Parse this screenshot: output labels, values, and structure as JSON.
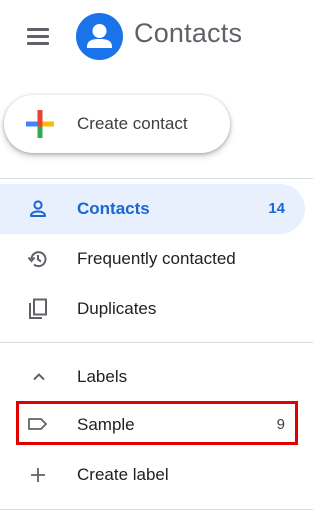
{
  "header": {
    "app_title": "Contacts",
    "menu_icon": "hamburger-menu-icon",
    "logo_icon": "person-avatar-icon",
    "logo_color": "#1a73e8"
  },
  "create_button": {
    "label": "Create contact",
    "icon": "multicolor-plus-icon"
  },
  "nav": {
    "items": [
      {
        "label": "Contacts",
        "count": "14",
        "icon": "person-outline-icon",
        "active": true
      },
      {
        "label": "Frequently contacted",
        "count": "",
        "icon": "history-icon",
        "active": false
      },
      {
        "label": "Duplicates",
        "count": "",
        "icon": "copy-icon",
        "active": false
      }
    ]
  },
  "labels_section": {
    "title": "Labels",
    "icon": "chevron-up-icon",
    "items": [
      {
        "label": "Sample",
        "count": "9",
        "icon": "label-tag-icon"
      }
    ],
    "create_label": "Create label",
    "create_icon": "plus-icon"
  },
  "colors": {
    "accent": "#1967d2",
    "active_bg": "#e8f0fe",
    "highlight_border": "#e00000"
  }
}
